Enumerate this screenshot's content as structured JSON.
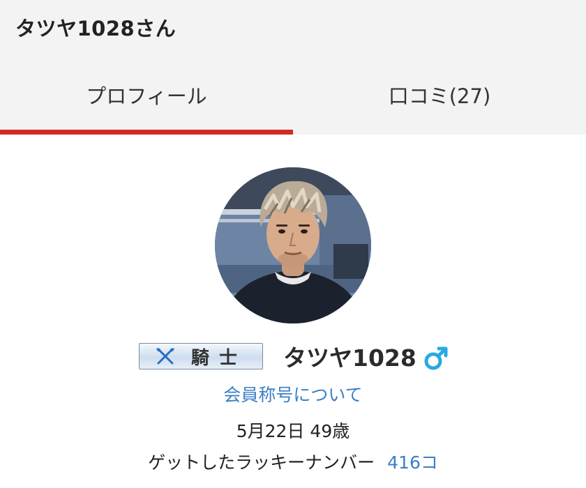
{
  "header": {
    "title": "タツヤ1028さん"
  },
  "tabs": [
    {
      "label": "プロフィール",
      "active": true
    },
    {
      "label": "口コミ(27)",
      "active": false
    }
  ],
  "profile": {
    "rank_title": "騎士",
    "rank_icon": "crossed-axes-icon",
    "username": "タツヤ1028",
    "gender_icon": "male-symbol-icon",
    "title_link": "会員称号について",
    "birthday_age": "5月22日 49歳",
    "lucky_label": "ゲットしたラッキーナンバー",
    "lucky_count": "416コ"
  },
  "colors": {
    "accent_red": "#d12a23",
    "link_blue": "#3b7fc4",
    "male_icon": "#29a9e1",
    "header_bg": "#f3f3f3"
  }
}
